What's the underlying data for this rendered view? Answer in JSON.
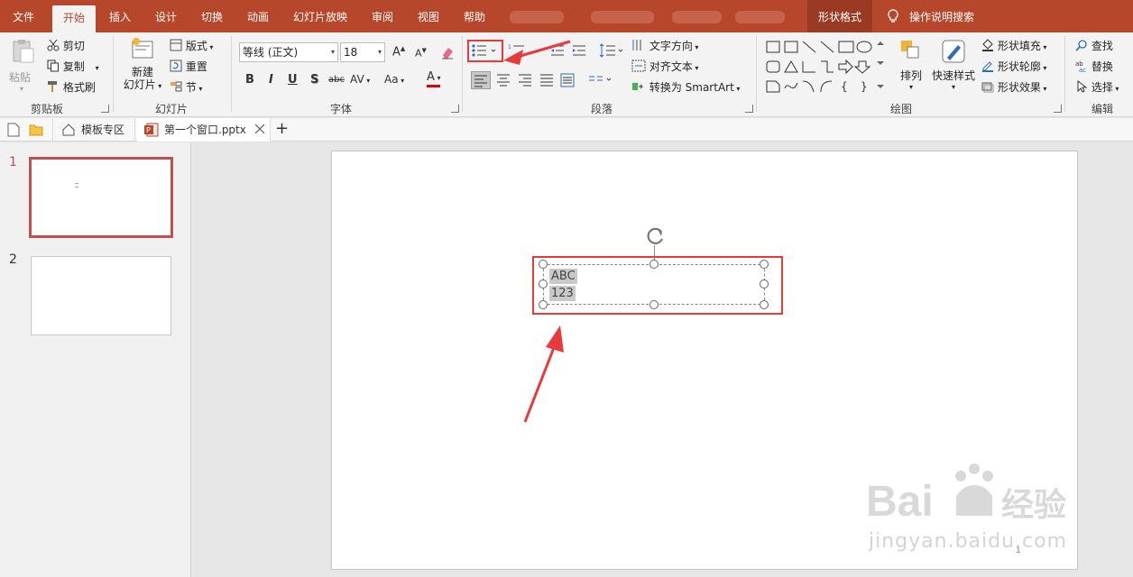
{
  "tabs": {
    "file": "文件",
    "home": "开始",
    "insert": "插入",
    "design": "设计",
    "transitions": "切换",
    "animations": "动画",
    "slideshow": "幻灯片放映",
    "review": "审阅",
    "view": "视图",
    "help": "帮助",
    "shape_format": "形状格式",
    "tell_me": "操作说明搜索"
  },
  "clipboard": {
    "paste": "粘贴",
    "cut": "剪切",
    "copy": "复制",
    "format_painter": "格式刷",
    "label": "剪贴板"
  },
  "slides": {
    "new_slide_line1": "新建",
    "new_slide_line2": "幻灯片",
    "layout": "版式",
    "reset": "重置",
    "section": "节",
    "label": "幻灯片"
  },
  "font": {
    "name": "等线 (正文)",
    "size": "18",
    "grow": "A",
    "shrink": "A",
    "bold": "B",
    "italic": "I",
    "underline": "U",
    "shadow": "S",
    "strike": "abc",
    "spacing": "AV",
    "case": "Aa",
    "color": "A",
    "label": "字体"
  },
  "paragraph": {
    "text_direction": "文字方向",
    "align_text": "对齐文本",
    "smartart": "转换为 SmartArt",
    "label": "段落"
  },
  "drawing": {
    "arrange": "排列",
    "quick_styles": "快速样式",
    "fill": "形状填充",
    "outline": "形状轮廓",
    "effects": "形状效果",
    "label": "绘图"
  },
  "editing": {
    "find": "查找",
    "replace": "替换",
    "select": "选择",
    "label": "编辑"
  },
  "doctabs": {
    "templates": "模板专区",
    "file": "第一个窗口.pptx",
    "add": "+"
  },
  "thumbnails": [
    {
      "num": "1"
    },
    {
      "num": "2"
    }
  ],
  "slide": {
    "line1": "ABC",
    "line2": "123",
    "page_number": "1"
  },
  "watermark": {
    "url": "jingyan.baidu.com"
  },
  "colors": {
    "accent": "#b7472a",
    "annotation_red": "#e83a3a"
  }
}
